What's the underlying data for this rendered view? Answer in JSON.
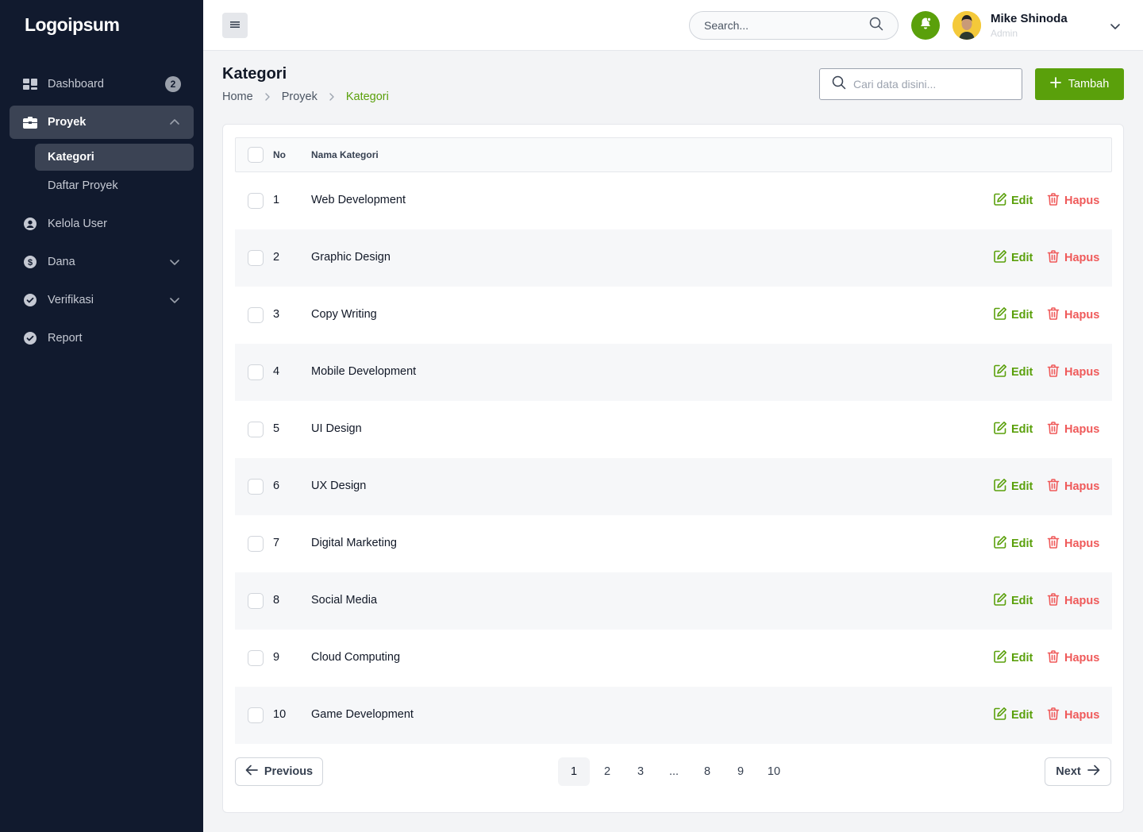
{
  "brand": {
    "logo_text": "Logoipsum",
    "accent": "#5aa00b",
    "danger": "#ef5a5a",
    "sidebar_bg": "#111a2e"
  },
  "sidebar": {
    "items": [
      {
        "label": "Dashboard",
        "icon": "dashboard-icon",
        "badge": "2"
      },
      {
        "label": "Proyek",
        "icon": "briefcase-icon",
        "active": true,
        "expanded": true,
        "children": [
          {
            "label": "Kategori",
            "active": true
          },
          {
            "label": "Daftar Proyek"
          }
        ]
      },
      {
        "label": "Kelola User",
        "icon": "user-circle-icon"
      },
      {
        "label": "Dana",
        "icon": "dollar-icon",
        "has_submenu": true
      },
      {
        "label": "Verifikasi",
        "icon": "check-circle-icon",
        "has_submenu": true
      },
      {
        "label": "Report",
        "icon": "check-circle-icon"
      }
    ]
  },
  "topbar": {
    "search_placeholder": "Search...",
    "user": {
      "name": "Mike Shinoda",
      "role": "Admin"
    }
  },
  "page": {
    "title": "Kategori",
    "breadcrumb": [
      "Home",
      "Proyek",
      "Kategori"
    ],
    "search_placeholder": "Cari data disini...",
    "add_label": "Tambah"
  },
  "table": {
    "columns": [
      "No",
      "Nama Kategori"
    ],
    "edit_label": "Edit",
    "delete_label": "Hapus",
    "rows": [
      {
        "no": "1",
        "name": "Web Development"
      },
      {
        "no": "2",
        "name": "Graphic Design"
      },
      {
        "no": "3",
        "name": "Copy Writing"
      },
      {
        "no": "4",
        "name": "Mobile Development"
      },
      {
        "no": "5",
        "name": "UI Design"
      },
      {
        "no": "6",
        "name": "UX Design"
      },
      {
        "no": "7",
        "name": "Digital Marketing"
      },
      {
        "no": "8",
        "name": "Social Media"
      },
      {
        "no": "9",
        "name": "Cloud Computing"
      },
      {
        "no": "10",
        "name": "Game Development"
      }
    ]
  },
  "pagination": {
    "prev_label": "Previous",
    "next_label": "Next",
    "pages": [
      "1",
      "2",
      "3",
      "...",
      "8",
      "9",
      "10"
    ],
    "current": "1"
  }
}
